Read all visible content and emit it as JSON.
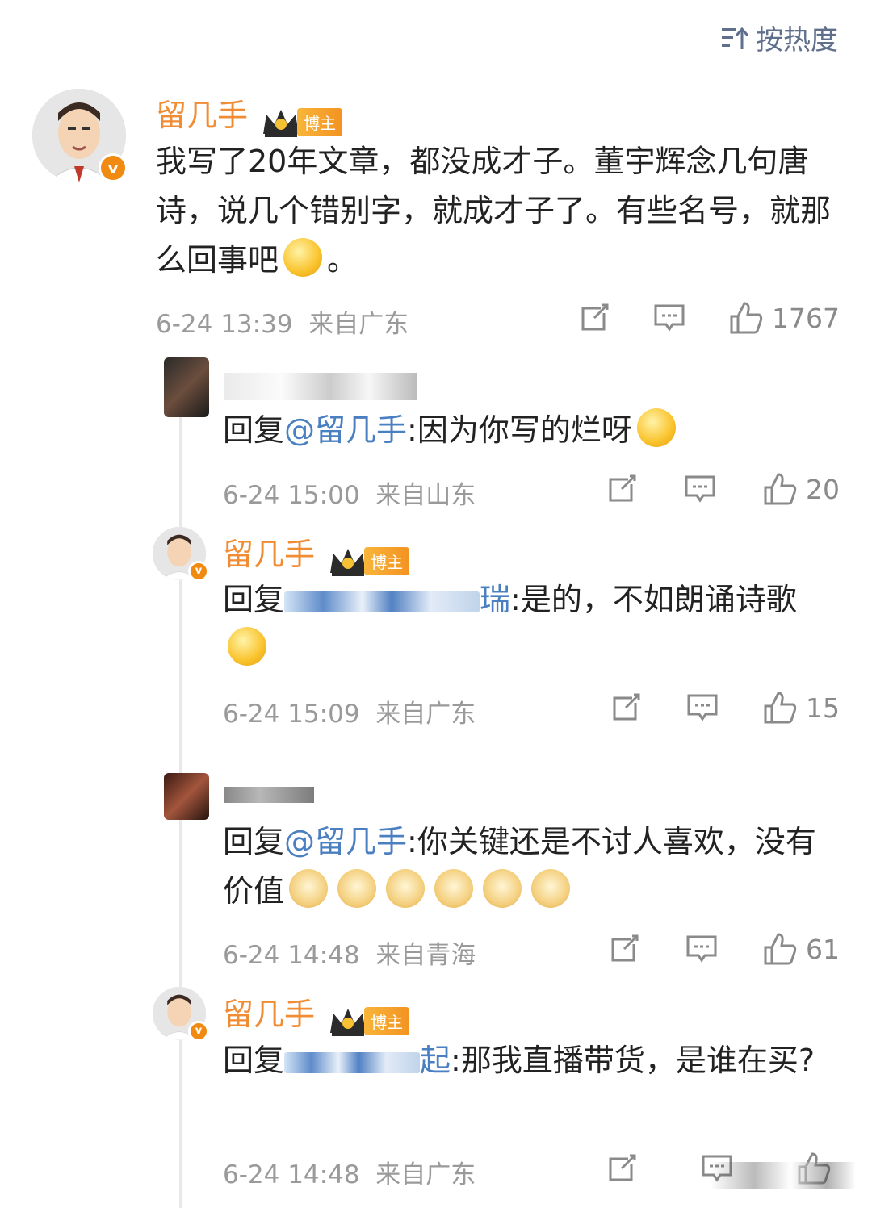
{
  "sort": {
    "label": "按热度"
  },
  "main_comment": {
    "author": "留几手",
    "badge": "博主",
    "text": "我写了20年文章，都没成才子。董宇辉念几句唐诗，说几个错别字，就成才子了。有些名号，就那么回事吧",
    "text_end": "。",
    "time": "6-24 13:39",
    "location": "来自广东",
    "likes": "1767"
  },
  "replies": [
    {
      "author": "",
      "reply_prefix": "回复",
      "mention": "@留几手",
      "text": ":因为你写的烂呀",
      "time": "6-24 15:00",
      "location": "来自山东",
      "likes": "20"
    },
    {
      "author": "留几手",
      "badge": "博主",
      "reply_prefix": "回复",
      "mention_tail": "瑞",
      "text": ":是的，不如朗诵诗歌",
      "time": "6-24 15:09",
      "location": "来自广东",
      "likes": "15"
    },
    {
      "author": "",
      "reply_prefix": "回复",
      "mention": "@留几手",
      "text": ":你关键还是不讨人喜欢，没有价值",
      "time": "6-24 14:48",
      "location": "来自青海",
      "likes": "61"
    },
    {
      "author": "留几手",
      "badge": "博主",
      "reply_prefix": "回复",
      "mention_tail": "起",
      "text": ":那我直播带货，是谁在买?",
      "time": "6-24 14:48",
      "location": "来自广东",
      "likes": ""
    }
  ],
  "colors": {
    "accent_name": "#f08c33",
    "mention": "#4a7fc1",
    "meta": "#9a9a9a"
  }
}
